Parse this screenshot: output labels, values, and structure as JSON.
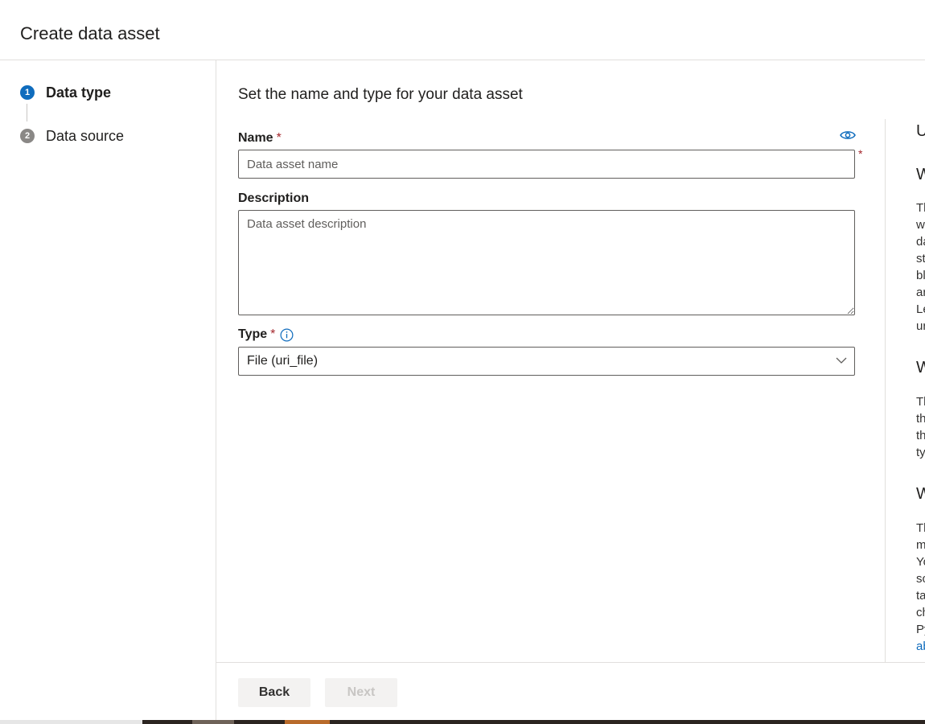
{
  "header": {
    "title": "Create data asset"
  },
  "steps": [
    {
      "number": "1",
      "label": "Data type",
      "active": true
    },
    {
      "number": "2",
      "label": "Data source",
      "active": false
    }
  ],
  "form": {
    "title": "Set the name and type for your data asset",
    "name": {
      "label": "Name",
      "required_mark": "*",
      "placeholder": "Data asset name",
      "value": ""
    },
    "description": {
      "label": "Description",
      "placeholder": "Data asset description",
      "value": ""
    },
    "type": {
      "label": "Type",
      "required_mark": "*",
      "selected": "File (uri_file)"
    },
    "side_required_mark": "*"
  },
  "info_panel": {
    "heading_top": "U",
    "sections": [
      {
        "heading": "W",
        "lines": [
          "Th",
          "w",
          "da",
          "st",
          "bl",
          "ar",
          "Le",
          "ur"
        ]
      },
      {
        "heading": "W",
        "lines": [
          "Th",
          "th",
          "th",
          "ty"
        ]
      },
      {
        "heading": "W",
        "lines": [
          "Th",
          "m",
          "Yo",
          "so",
          "ta",
          "ch",
          "Py"
        ],
        "link": "ab"
      }
    ]
  },
  "footer": {
    "back_label": "Back",
    "next_label": "Next"
  },
  "colors": {
    "accent": "#0f6cbd",
    "required": "#a4262c",
    "border": "#605e5c"
  },
  "icons": {
    "eye": "eye-icon",
    "info": "info-icon",
    "chevron": "chevron-down-icon"
  }
}
